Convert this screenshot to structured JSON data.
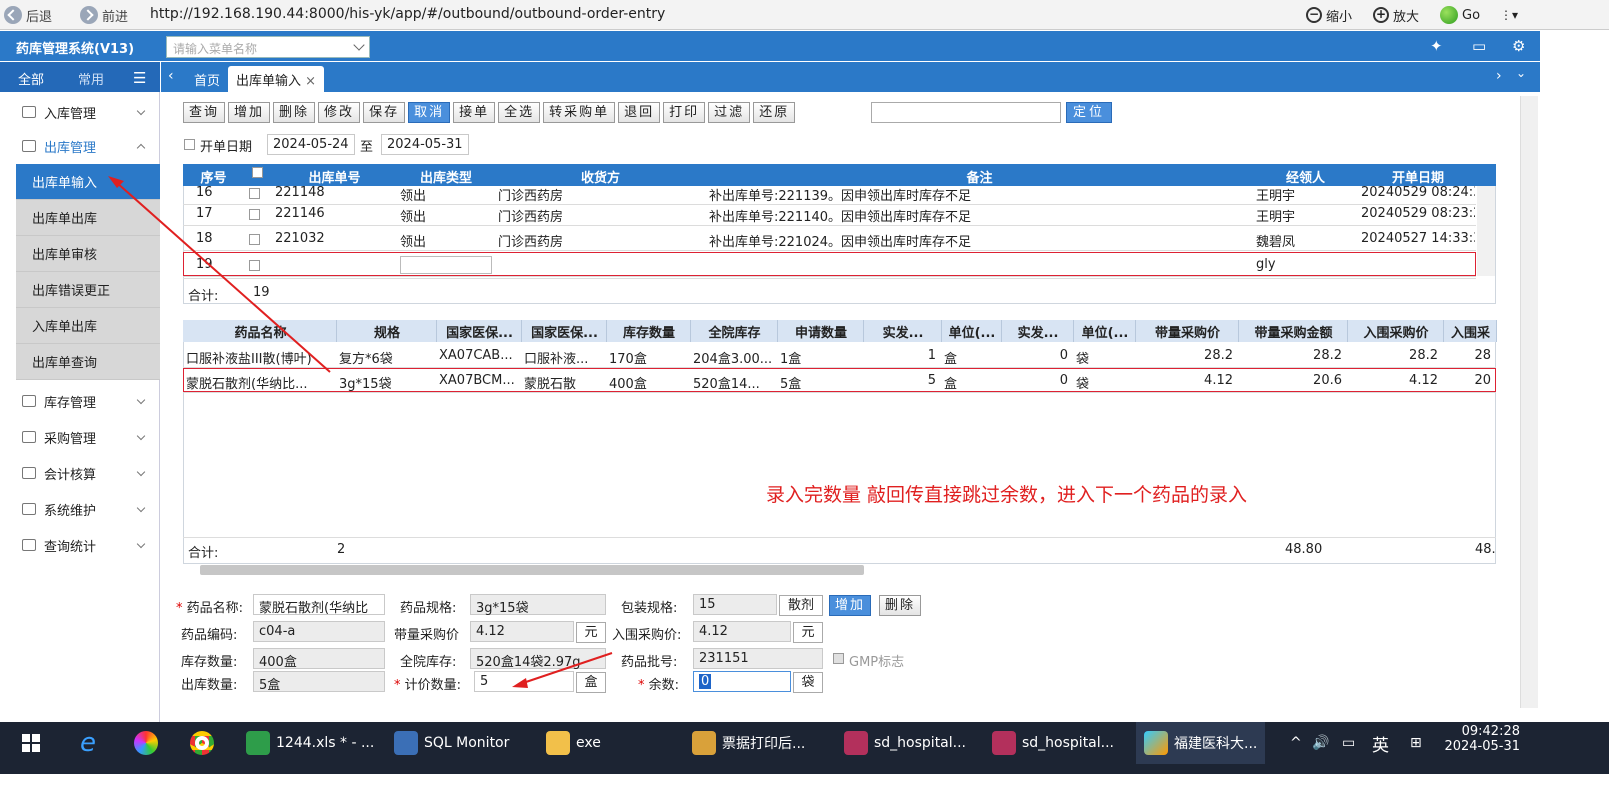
{
  "browser": {
    "back": "后退",
    "forward": "前进",
    "url": "http://192.168.190.44:8000/his-yk/app/#/outbound/outbound-order-entry",
    "zoom_out": "缩小",
    "zoom_in": "放大",
    "go": "Go"
  },
  "app": {
    "title": "药库管理系统(V13)",
    "menu_search_placeholder": "请输入菜单名称"
  },
  "sidebar": {
    "tabs": [
      "全部",
      "常用"
    ],
    "items": [
      {
        "label": "入库管理",
        "expanded": false
      },
      {
        "label": "出库管理",
        "expanded": true,
        "children": [
          "出库单输入",
          "出库单出库",
          "出库单审核",
          "出库错误更正",
          "入库单出库",
          "出库单查询"
        ]
      },
      {
        "label": "库存管理",
        "expanded": false
      },
      {
        "label": "采购管理",
        "expanded": false
      },
      {
        "label": "会计核算",
        "expanded": false
      },
      {
        "label": "系统维护",
        "expanded": false
      },
      {
        "label": "查询统计",
        "expanded": false
      }
    ],
    "active_child": "出库单输入"
  },
  "tabs": {
    "home": "首页",
    "current": "出库单输入"
  },
  "toolbar": [
    "查询",
    "增加",
    "删除",
    "修改",
    "保存",
    "取消",
    "接单",
    "全选",
    "转采购单",
    "退回",
    "打印",
    "过滤",
    "还原"
  ],
  "toolbar_active": "取消",
  "locate_button": "定位",
  "date_filter": {
    "label": "开单日期",
    "from": "2024-05-24",
    "sep": "至",
    "to": "2024-05-31"
  },
  "orders": {
    "columns": [
      "序号",
      "",
      "出库单号",
      "出库类型",
      "收货方",
      "备注",
      "经领人",
      "开单日期"
    ],
    "rows": [
      [
        "16",
        "",
        "221148",
        "领出",
        "门诊西药房",
        "补出库单号:221139。因申领出库时库存不足",
        "王明宇",
        "20240529 08:24:3"
      ],
      [
        "17",
        "",
        "221146",
        "领出",
        "门诊西药房",
        "补出库单号:221140。因申领出库时库存不足",
        "王明宇",
        "20240529 08:23:2"
      ],
      [
        "18",
        "",
        "221032",
        "领出",
        "门诊西药房",
        "补出库单号:221024。因申领出库时库存不足",
        "魏碧凤",
        "20240527 14:33:3"
      ],
      [
        "19",
        "",
        "",
        "",
        "",
        "",
        "gly",
        ""
      ]
    ],
    "total_label": "合计:",
    "total_value": "19"
  },
  "details": {
    "columns": [
      "药品名称",
      "规格",
      "国家医保...",
      "国家医保...",
      "库存数量",
      "全院库存",
      "申请数量",
      "实发...",
      "单位(...",
      "实发...",
      "单位(...",
      "带量采购价",
      "带量采购金额",
      "入围采购价",
      "入围采"
    ],
    "rows": [
      [
        "口服补液盐III散(博叶)",
        "复方*6袋",
        "XA07CAB...",
        "口服补液...",
        "170盒",
        "204盒3.00...",
        "1盒",
        "1",
        "盒",
        "0",
        "袋",
        "28.2",
        "28.2",
        "28.2",
        "28"
      ],
      [
        "蒙脱石散剂(华纳比...",
        "3g*15袋",
        "XA07BCM...",
        "蒙脱石散",
        "400盒",
        "520盒14...",
        "5盒",
        "5",
        "盒",
        "0",
        "袋",
        "4.12",
        "20.6",
        "4.12",
        "20"
      ]
    ],
    "total_label": "合计:",
    "total_count": "2",
    "total_amount": "48.80",
    "total_amount2": "48."
  },
  "annotation": "录入完数量 敲回传直接跳过余数，进入下一个药品的录入",
  "form": {
    "drug_name_label": "药品名称:",
    "drug_name": "蒙脱石散剂(华纳比",
    "spec_label": "药品规格:",
    "spec": "3g*15袋",
    "pack_label": "包装规格:",
    "pack": "15",
    "pack_unit": "散剂",
    "add_btn": "增加",
    "del_btn": "删除",
    "code_label": "药品编码:",
    "code": "c04-a",
    "vbp_price_label": "带量采购价",
    "vbp_price": "4.12",
    "vbp_unit": "元",
    "bid_price_label": "入围采购价:",
    "bid_price": "4.12",
    "bid_unit": "元",
    "stock_label": "库存数量:",
    "stock": "400盒",
    "hosp_stock_label": "全院库存:",
    "hosp_stock": "520盒14袋2.97g",
    "batch_label": "药品批号:",
    "batch": "231151",
    "gmp_label": "GMP标志",
    "out_qty_label": "出库数量:",
    "out_qty": "5盒",
    "price_qty_label": "计价数量:",
    "price_qty": "5",
    "price_qty_unit": "盒",
    "remainder_label": "余数:",
    "remainder": "0",
    "remainder_unit": "袋"
  },
  "taskbar": {
    "items": [
      "1244.xls * - ...",
      "SQL Monitor",
      "exe",
      "票据打印后...",
      "sd_hospital...",
      "sd_hospital...",
      "福建医科大..."
    ],
    "ime": "英",
    "time": "09:42:28",
    "date": "2024-05-31"
  },
  "colors": {
    "primary": "#2b79c8",
    "highlight_red": "#e02020"
  }
}
